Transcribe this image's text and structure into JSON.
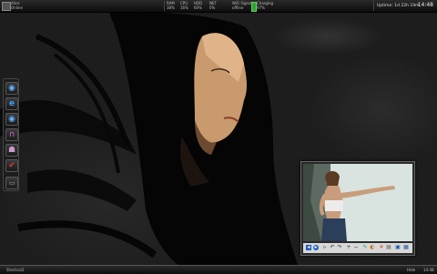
{
  "topbar": {
    "user": {
      "line1": "Alice",
      "line2": "Online"
    },
    "ram": {
      "label": "RAM",
      "value": "38%"
    },
    "cpu": {
      "label": "CPU",
      "value": "16%"
    },
    "hdd": {
      "label": "HDD",
      "value": "60%"
    },
    "net": {
      "label": "NET",
      "value": "0%"
    },
    "wifi": {
      "label": "WiFi Signal",
      "value": "offline"
    },
    "battery": {
      "label": "Charging",
      "value": "97%"
    },
    "uptime": "Uptime: 1d 22h 19m",
    "clock": "14:48"
  },
  "dock": {
    "icons": [
      "eye-icon",
      "ie-icon",
      "eye-icon",
      "headphones-icon",
      "user-icon",
      "check-icon",
      "folder-icon"
    ]
  },
  "viewer": {
    "toolbar_icons": [
      "previous-icon",
      "play-icon",
      "next-icon",
      "rotate-left-icon",
      "rotate-right-icon",
      "zoom-in-icon",
      "zoom-out-icon",
      "edit-icon",
      "color-icon",
      "delete-icon",
      "print-icon",
      "save-icon",
      "info-icon"
    ]
  },
  "taskbar": {
    "left": "Shortcut2",
    "right1": "Hide",
    "right2": "14:48"
  }
}
